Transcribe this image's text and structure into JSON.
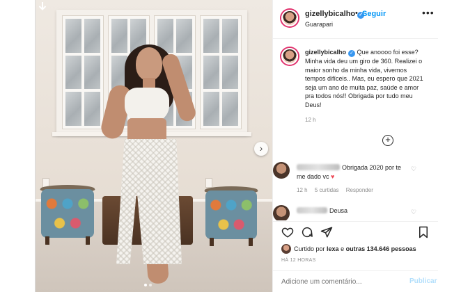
{
  "header": {
    "username": "gizellybicalho",
    "separator": "•",
    "follow_label": "Seguir",
    "location": "Guarapari",
    "more": "•••"
  },
  "caption": {
    "username": "gizellybicalho",
    "text": "Que anoooo foi esse? Minha vida deu um giro de 360. Realizei o maior sonho da minha vida, vivemos tempos difíceis.. Mas, eu espero que 2021 seja um ano de muita paz, saúde e amor pra todos nós!! Obrigada por tudo meu Deus!",
    "time": "12 h"
  },
  "load_more": "+",
  "comments": [
    {
      "text": "Obrigada 2020 por te me dado vc",
      "emoji": "♥",
      "time": "12 h",
      "likes": "5 curtidas",
      "reply": "Responder"
    },
    {
      "text": "Deusa"
    }
  ],
  "actions": {
    "liked_by_prefix": "Curtido por",
    "liked_by_user": "lexa",
    "liked_by_middle": "e",
    "liked_by_count": "outras 134.646 pessoas",
    "time_ago": "HÁ 12 HORAS"
  },
  "composer": {
    "placeholder": "Adicione um comentário...",
    "publish_label": "Publicar"
  },
  "colors": {
    "accent": "#0095f6",
    "verified": "#3897f0",
    "heart": "#ed4956"
  }
}
